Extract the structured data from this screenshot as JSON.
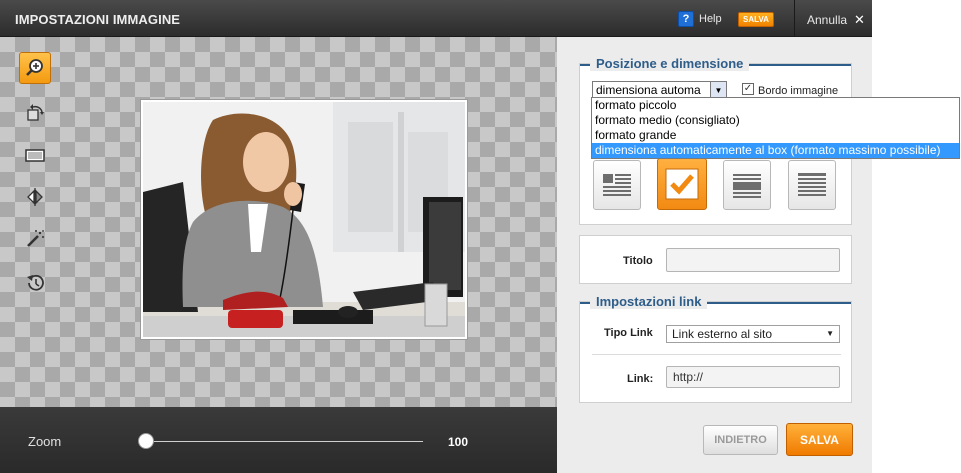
{
  "header": {
    "title": "IMPOSTAZIONI IMMAGINE",
    "help_icon_label": "?",
    "help_label": "Help",
    "save_label": "SALVA",
    "cancel_label": "Annulla",
    "close_glyph": "✕"
  },
  "tools": [
    {
      "name": "zoom-icon",
      "active": true
    },
    {
      "name": "rotate-icon",
      "active": false
    },
    {
      "name": "fit-frame-icon",
      "active": false
    },
    {
      "name": "flip-icon",
      "active": false
    },
    {
      "name": "magic-wand-icon",
      "active": false
    },
    {
      "name": "history-icon",
      "active": false
    }
  ],
  "zoom": {
    "label": "Zoom",
    "value": "100"
  },
  "position_size": {
    "legend": "Posizione e dimensione",
    "select_value": "dimensiona automa",
    "border_label": "Bordo immagine",
    "border_checked": true,
    "border_check_glyph": "✓",
    "dropdown_options": [
      "formato piccolo",
      "formato medio (consigliato)",
      "formato grande",
      "dimensiona automaticamente al box (formato massimo possibile)"
    ],
    "selected_option_index": 3,
    "layout_buttons": [
      "text-left-layout-icon",
      "check-layout-icon",
      "text-wrap-layout-icon",
      "text-below-layout-icon"
    ],
    "active_layout_index": 1
  },
  "title_field": {
    "label": "Titolo",
    "value": ""
  },
  "link_settings": {
    "legend": "Impostazioni link",
    "type_label": "Tipo Link",
    "type_value": "Link esterno al sito",
    "link_label": "Link:",
    "link_value": "http://"
  },
  "footer": {
    "back_label": "INDIETRO",
    "save_label": "SALVA"
  },
  "colors": {
    "accent_orange": "#f39a10",
    "legend_blue": "#2e5d8a",
    "selection_blue": "#3399ff"
  }
}
